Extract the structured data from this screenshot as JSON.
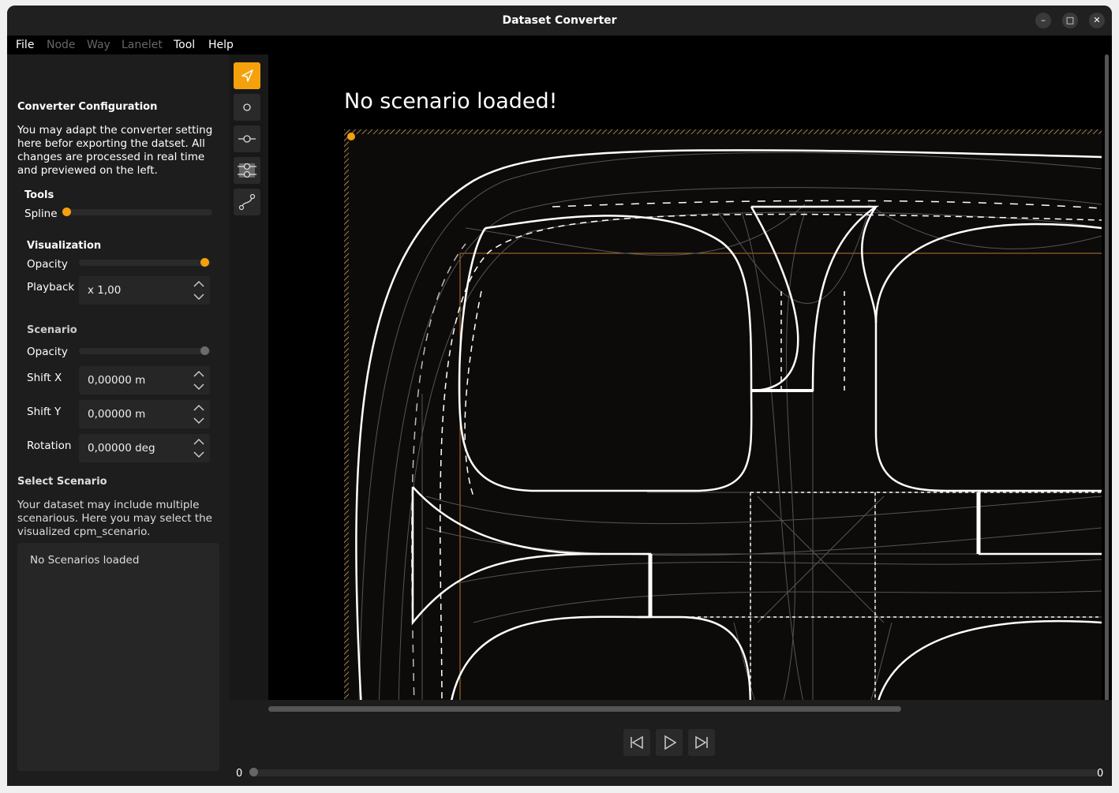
{
  "window": {
    "title": "Dataset Converter"
  },
  "menu": [
    "File",
    "Node",
    "Way",
    "Lanelet",
    "Tool",
    "Help"
  ],
  "menu_disabled": [
    false,
    true,
    true,
    true,
    false,
    false
  ],
  "config": {
    "heading": "Converter Configuration",
    "desc_lines": [
      "You may adapt the converter setting",
      "here befor exporting the datset. All",
      "changes are processed in real time",
      "and previewed on the left."
    ]
  },
  "tools": {
    "heading": "Tools",
    "spline_label": "Spline",
    "spline_level": 0.0
  },
  "visualization": {
    "heading": "Visualization",
    "opacity_label": "Opacity",
    "opacity_level": 1.0,
    "playback_label": "Playback",
    "playback_value": "x 1,00"
  },
  "scenario": {
    "heading": "Scenario",
    "opacity_label": "Opacity",
    "opacity_level": 1.0,
    "shift_x_label": "Shift X",
    "shift_x_value": "0,00000 m",
    "shift_y_label": "Shift Y",
    "shift_y_value": "0,00000 m",
    "rotation_label": "Rotation",
    "rotation_value": "0,00000 deg"
  },
  "select_scenario": {
    "heading": "Select Scenario",
    "desc_lines": [
      "Your dataset may include multiple",
      "scenarious. Here you may select the",
      "visualized cpm_scenario."
    ],
    "empty_text": "No Scenarios loaded"
  },
  "canvas": {
    "message": "No scenario loaded!"
  },
  "tools_column": [
    "select-arrow-icon",
    "node-icon",
    "way-icon",
    "lanelet-icon",
    "spline-icon"
  ],
  "timeline": {
    "start": "0",
    "end": "0",
    "position": 0
  },
  "colors": {
    "accent": "#f4a10b",
    "panel": "#1d1d1d",
    "road": "#ffffff",
    "guide": "#888888"
  }
}
